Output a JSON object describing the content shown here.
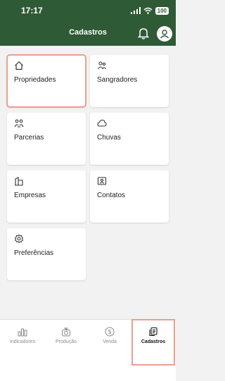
{
  "status": {
    "time": "17:17",
    "battery": "100"
  },
  "header": {
    "title": "Cadastros"
  },
  "cards": [
    {
      "label": "Propriedades",
      "icon": "house-icon"
    },
    {
      "label": "Sangradores",
      "icon": "people-icon"
    },
    {
      "label": "Parcerias",
      "icon": "partners-icon"
    },
    {
      "label": "Chuvas",
      "icon": "cloud-icon"
    },
    {
      "label": "Empresas",
      "icon": "building-icon"
    },
    {
      "label": "Contatos",
      "icon": "contact-card-icon"
    },
    {
      "label": "Preferências",
      "icon": "gear-icon"
    }
  ],
  "bottom_nav": {
    "items": [
      {
        "label": "Indicadores",
        "icon": "bar-chart-icon"
      },
      {
        "label": "Produção",
        "icon": "scale-icon"
      },
      {
        "label": "Venda",
        "icon": "dollar-icon"
      },
      {
        "label": "Cadastros",
        "icon": "documents-icon"
      }
    ],
    "active": "Cadastros"
  },
  "colors": {
    "header_bg": "#2f5a36",
    "selection_outline": "#e8a08e"
  }
}
